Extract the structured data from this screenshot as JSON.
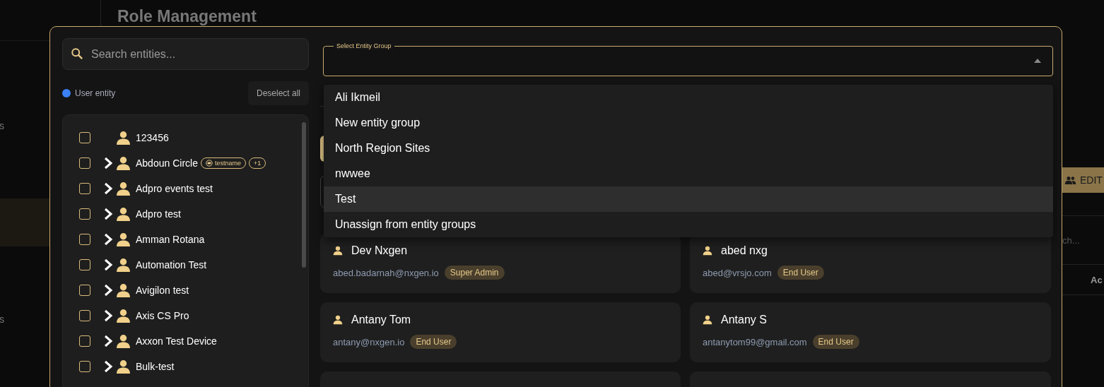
{
  "sidebar": {
    "items": [
      {
        "label": "s",
        "selected": false
      },
      {
        "selected": true
      },
      {
        "label": "s",
        "selected": false
      }
    ]
  },
  "page": {
    "title": "Role Management"
  },
  "background_panel": {
    "edit_button": "EDIT",
    "search_placeholder": "ch...",
    "column_header": "Ac"
  },
  "modal": {
    "search": {
      "placeholder": "Search entities..."
    },
    "legend": {
      "label": "User entity",
      "color": "#3b82f6"
    },
    "deselect_button": "Deselect all",
    "entities": [
      {
        "name": "123456",
        "checked": false,
        "has_children": false
      },
      {
        "name": "Abdoun Circle",
        "checked": false,
        "has_children": true,
        "tags": [
          {
            "label": "testname",
            "kind": "icon"
          },
          {
            "label": "+1",
            "kind": "count"
          }
        ]
      },
      {
        "name": "Adpro events test",
        "checked": false,
        "has_children": true
      },
      {
        "name": "Adpro test",
        "checked": false,
        "has_children": true
      },
      {
        "name": "Amman Rotana",
        "checked": false,
        "has_children": true
      },
      {
        "name": "Automation Test",
        "checked": false,
        "has_children": true
      },
      {
        "name": "Avigilon test",
        "checked": false,
        "has_children": true
      },
      {
        "name": "Axis CS Pro",
        "checked": false,
        "has_children": true
      },
      {
        "name": "Axxon Test Device",
        "checked": false,
        "has_children": true
      },
      {
        "name": "Bulk-test",
        "checked": false,
        "has_children": true
      }
    ],
    "entity_group_select": {
      "label": "Select Entity Group",
      "expanded": true,
      "options": [
        {
          "label": "Ali Ikmeil",
          "selected": false
        },
        {
          "label": "New entity group",
          "selected": false
        },
        {
          "label": "North Region Sites",
          "selected": false
        },
        {
          "label": "nwwee",
          "selected": false
        },
        {
          "label": "Test",
          "selected": true
        },
        {
          "label": "Unassign from entity groups",
          "selected": false
        }
      ]
    },
    "users": [
      {
        "name": "Dev Nxgen",
        "email": "abed.badarnah@nxgen.io",
        "role": "Super Admin"
      },
      {
        "name": "abed nxg",
        "email": "abed@vrsjo.com",
        "role": "End User"
      },
      {
        "name": "Antany Tom",
        "email": "antany@nxgen.io",
        "role": "End User"
      },
      {
        "name": "Antany S",
        "email": "antanytom99@gmail.com",
        "role": "End User"
      }
    ]
  }
}
